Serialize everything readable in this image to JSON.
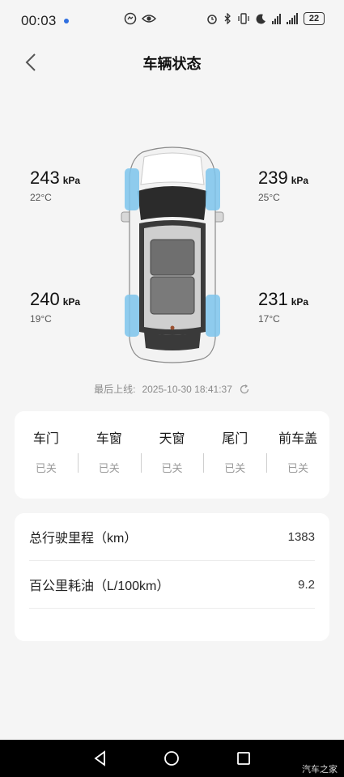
{
  "status_bar": {
    "time": "00:03",
    "battery": "22",
    "icons": [
      "messenger-icon",
      "eye-icon",
      "alarm-icon",
      "bluetooth-icon",
      "vibrate-icon",
      "moon-icon",
      "signal-icon",
      "wifi-icon",
      "battery-icon"
    ]
  },
  "nav": {
    "title": "车辆状态",
    "back_icon": "chevron-left-icon"
  },
  "tires": {
    "front_left": {
      "pressure": "243",
      "unit": "kPa",
      "temp": "22°C"
    },
    "front_right": {
      "pressure": "239",
      "unit": "kPa",
      "temp": "25°C"
    },
    "rear_left": {
      "pressure": "240",
      "unit": "kPa",
      "temp": "19°C"
    },
    "rear_right": {
      "pressure": "231",
      "unit": "kPa",
      "temp": "17°C"
    }
  },
  "last_online": {
    "label": "最后上线:",
    "time": "2025-10-30 18:41:37",
    "refresh_icon": "refresh-icon"
  },
  "doors": [
    {
      "name": "车门",
      "state": "已关"
    },
    {
      "name": "车窗",
      "state": "已关"
    },
    {
      "name": "天窗",
      "state": "已关"
    },
    {
      "name": "尾门",
      "state": "已关"
    },
    {
      "name": "前车盖",
      "state": "已关"
    }
  ],
  "stats": [
    {
      "label": "总行驶里程（km）",
      "value": "1383"
    },
    {
      "label": "百公里耗油（L/100km）",
      "value": "9.2"
    }
  ],
  "system_nav": {
    "icons": [
      "back-triangle-icon",
      "home-circle-icon",
      "recents-square-icon"
    ],
    "watermark": "汽车之家"
  },
  "colors": {
    "accent_tire": "#7cc4ec",
    "background": "#f5f5f5",
    "card": "#ffffff"
  }
}
